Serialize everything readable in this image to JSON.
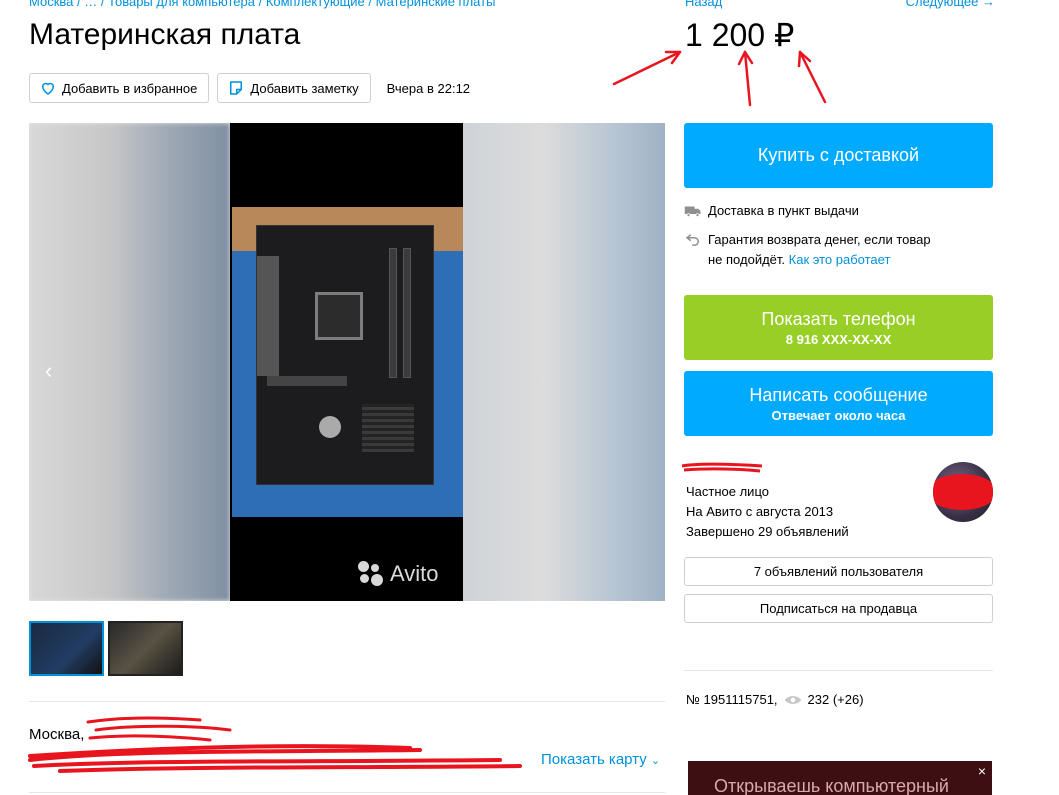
{
  "breadcrumb": "Москва / … / Товары для компьютера / Комплектующие / Материнские платы",
  "nav": {
    "back": "Назад",
    "next": "Следующее →"
  },
  "listing": {
    "title": "Материнская плата",
    "price": "1 200 ₽",
    "date": "Вчера в 22:12",
    "favorite_label": "Добавить в избранное",
    "note_label": "Добавить заметку",
    "item_number": "№ 1951115751,",
    "views": "232 (+26)"
  },
  "gallery": {
    "prev_arrow": "‹",
    "next_arrow": "›",
    "watermark": "Avito"
  },
  "location": {
    "city": "Москва,",
    "show_map": "Показать карту"
  },
  "buy": {
    "label": "Купить с доставкой",
    "delivery": "Доставка в пункт выдачи",
    "guarantee_line1": "Гарантия возврата денег, если товар",
    "guarantee_line2": "не подойдёт.",
    "how_it_works": "Как это работает"
  },
  "contact": {
    "phone_label": "Показать телефон",
    "phone_number": "8 916 XXX-XX-XX",
    "message_label": "Написать сообщение",
    "message_sub": "Отвечает около часа"
  },
  "seller": {
    "type": "Частное лицо",
    "since": "На Авито с августа 2013",
    "completed": "Завершено 29 объявлений",
    "listings_button": "7 объявлений пользователя",
    "subscribe_button": "Подписаться на продавца"
  },
  "ad": {
    "text": "Открываешь компьютерный",
    "close": "×"
  },
  "colors": {
    "link": "#0091d9",
    "primary_blue": "#00aaff",
    "green": "#97cf26",
    "annotation_red": "#e8151f"
  }
}
